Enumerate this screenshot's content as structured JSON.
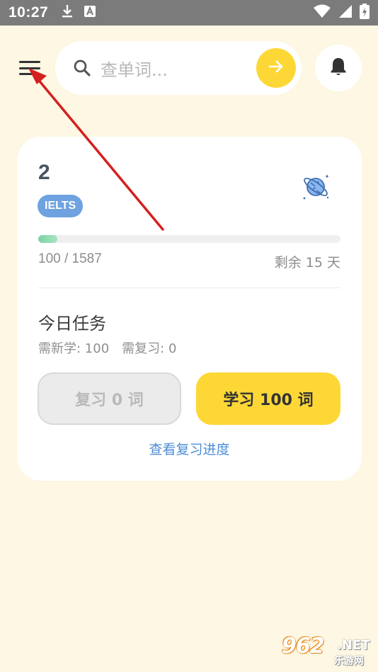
{
  "status_bar": {
    "time": "10:27",
    "icons": [
      "download-icon",
      "font-icon",
      "wifi-icon",
      "signal-icon",
      "battery-charging-icon"
    ]
  },
  "header": {
    "menu_icon": "hamburger-menu-icon",
    "search": {
      "placeholder": "查单词..."
    },
    "go_icon": "arrow-right-icon",
    "bell_icon": "bell-icon"
  },
  "book_card": {
    "count": "2",
    "exam_tag": "IELTS",
    "icon": "planet-icon",
    "progress": {
      "text": "100 / 1587",
      "learned": 100,
      "total": 1587
    },
    "days_left": "剩余 15 天",
    "today_task": {
      "title": "今日任务",
      "new_words": "需新学: 100",
      "review_words": "需复习: 0"
    },
    "review_button": "复习 0 词",
    "learn_button": "学习 100 词",
    "review_progress_link": "查看复习进度"
  },
  "colors": {
    "background": "#FDF7E3",
    "accent_yellow": "#FDD736",
    "badge_blue": "#6FA2E0",
    "link_blue": "#4C8DD6",
    "progress_green": "#7BD3A4",
    "annotation_red": "#D42020"
  },
  "watermark": {
    "main": "962",
    "suffix": ".NET",
    "sub": "乐游网"
  }
}
